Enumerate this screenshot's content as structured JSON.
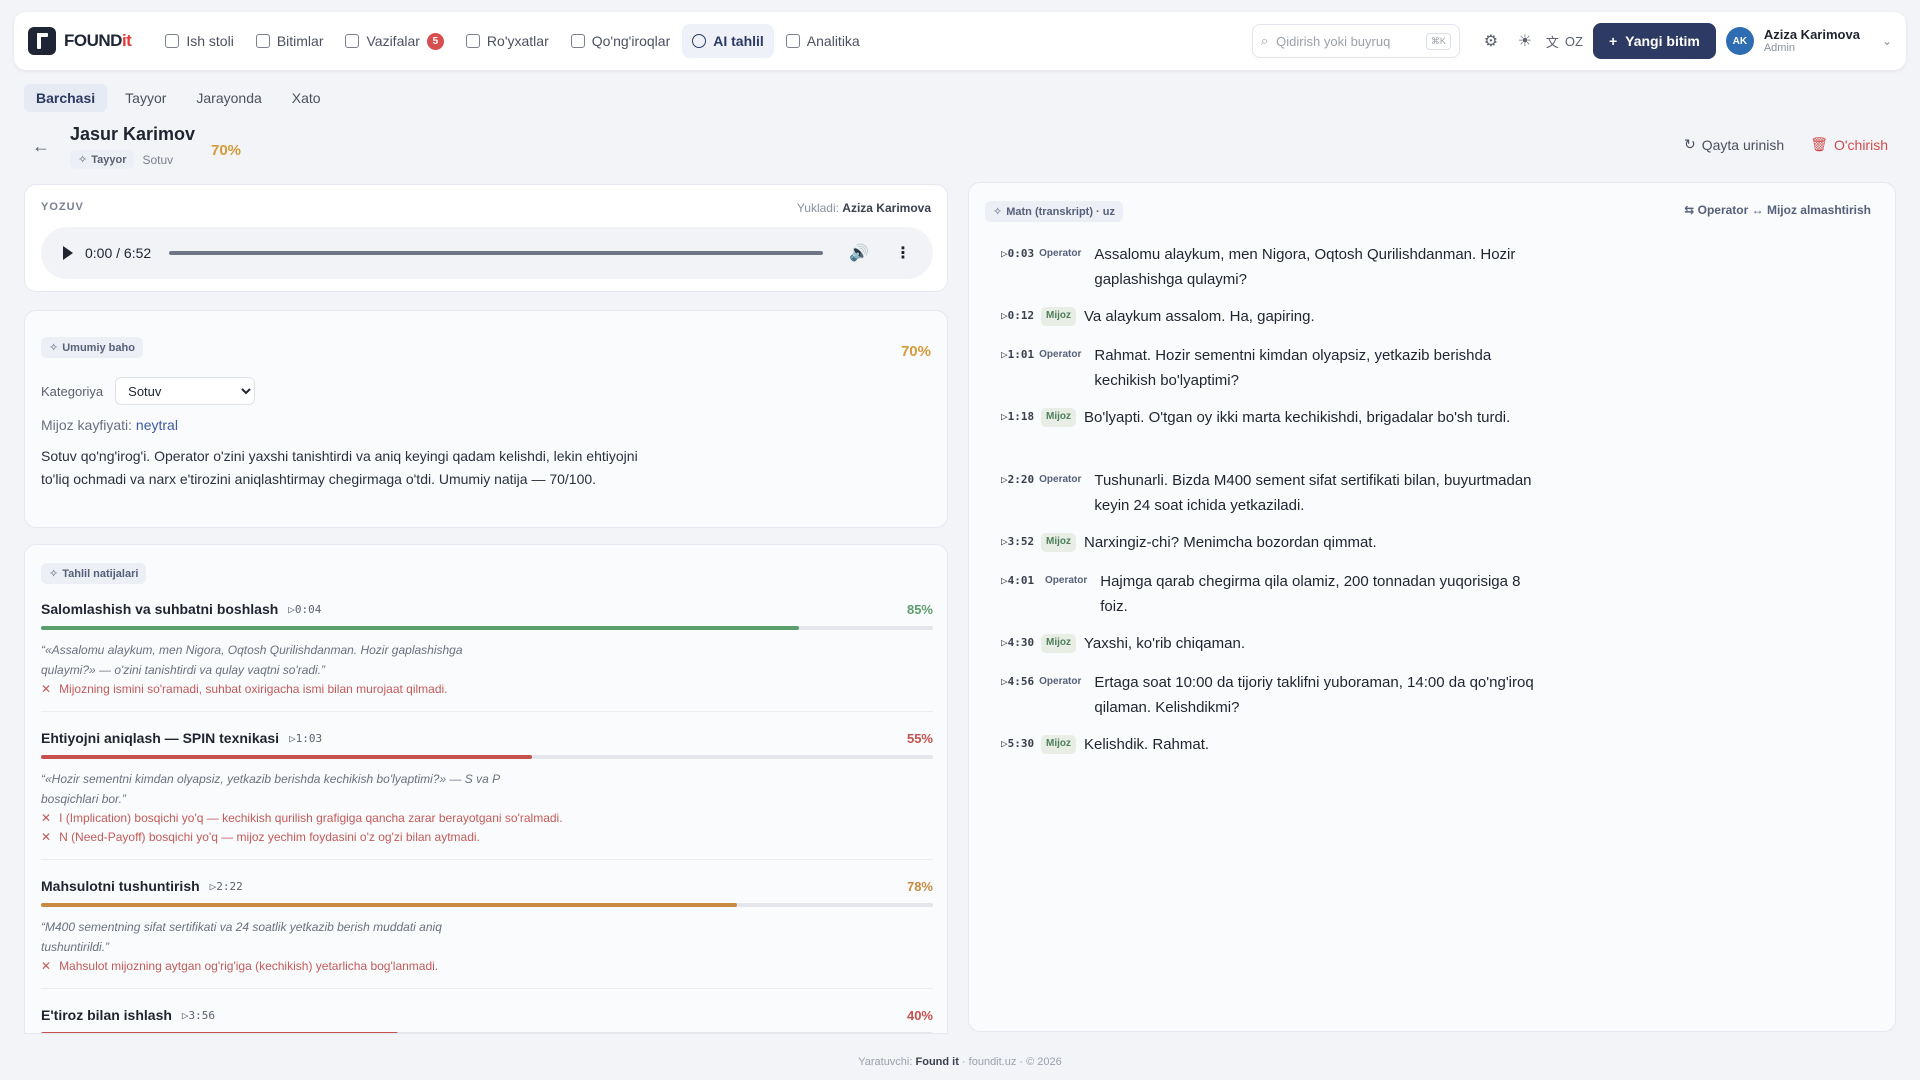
{
  "brand": {
    "prefix": "FOUND",
    "suffix": "it"
  },
  "nav": [
    {
      "label": "Ish stoli",
      "icon": "desk-icon"
    },
    {
      "label": "Bitimlar",
      "icon": "handshake-icon"
    },
    {
      "label": "Vazifalar",
      "icon": "checkbox-icon",
      "badge": "5"
    },
    {
      "label": "Ro'yxatlar",
      "icon": "list-icon"
    },
    {
      "label": "Qo'ng'iroqlar",
      "icon": "phone-icon"
    },
    {
      "label": "AI tahlil",
      "icon": "sparkle-icon",
      "active": true
    },
    {
      "label": "Analitika",
      "icon": "chart-icon"
    }
  ],
  "search": {
    "placeholder": "Qidirish yoki buyruq",
    "shortcut": "⌘K"
  },
  "lang": "OZ",
  "new_button": "Yangi bitim",
  "user": {
    "initials": "AK",
    "name": "Aziza Karimova",
    "role": "Admin"
  },
  "filter_tabs": [
    "Barchasi",
    "Tayyor",
    "Jarayonda",
    "Xato"
  ],
  "call": {
    "title": "Jasur Karimov",
    "status": "Tayyor",
    "category": "Sotuv",
    "score": "70%",
    "retry": "Qayta urinish",
    "delete": "O'chirish"
  },
  "audio": {
    "label": "YOZUV",
    "uploader_label": "Yukladi:",
    "uploader": "Aziza Karimova",
    "time": "0:00 / 6:52"
  },
  "overall": {
    "chip": "Umumiy baho",
    "score": "70%",
    "category_label": "Kategoriya",
    "category_value": "Sotuv",
    "mood_label": "Mijoz kayfiyati:",
    "mood_value": "neytral",
    "summary": "Sotuv qo'ng'irog'i. Operator o'zini yaxshi tanishtirdi va aniq keyingi qadam kelishdi, lekin ehtiyojni to'liq ochmadi va narx e'tirozini aniqlashtirmay chegirmaga o'tdi. Umumiy natija — 70/100."
  },
  "results": {
    "chip": "Tahlil natijalari",
    "metrics": [
      {
        "title": "Salomlashish va suhbatni boshlash",
        "time": "▷0:04",
        "pct": "85%",
        "value": 0.85,
        "color": "#5b9e6d",
        "quote": "“«Assalomu alaykum, men Nigora, Oqtosh Qurilishdanman. Hozir gaplashishga qulaymi?» — o'zini tanishtirdi va qulay vaqtni so'radi.”",
        "issues": [
          "Mijozning ismini so'ramadi, suhbat oxirigacha ismi bilan murojaat qilmadi."
        ]
      },
      {
        "title": "Ehtiyojni aniqlash — SPIN texnikasi",
        "time": "▷1:03",
        "pct": "55%",
        "value": 0.55,
        "color": "#c6504e",
        "quote": "“«Hozir sementni kimdan olyapsiz, yetkazib berishda kechikish bo'lyaptimi?» — S va P bosqichlari bor.”",
        "issues": [
          "I (Implication) bosqichi yo'q — kechikish qurilish grafigiga qancha zarar berayotgani so'ralmadi.",
          "N (Need-Payoff) bosqichi yo'q — mijoz yechim foydasini o'z og'zi bilan aytmadi."
        ]
      },
      {
        "title": "Mahsulotni tushuntirish",
        "time": "▷2:22",
        "pct": "78%",
        "value": 0.78,
        "color": "#c98a42",
        "quote": "“M400 sementning sifat sertifikati va 24 soatlik yetkazib berish muddati aniq tushuntirildi.”",
        "issues": [
          "Mahsulot mijozning aytgan og'rig'iga (kechikish) yetarlicha bog'lanmadi."
        ]
      },
      {
        "title": "E'tiroz bilan ishlash",
        "time": "▷3:56",
        "pct": "40%",
        "value": 0.4,
        "color": "#c6504e",
        "quote": "",
        "issues": []
      }
    ]
  },
  "transcript": {
    "chip": "Matn (transkript) · uz",
    "swap": "⇆ Operator ↔ Mijoz almashtirish",
    "lines": [
      {
        "time": "▷0:03",
        "speaker": "Operator",
        "role": "op",
        "text": "Assalomu alaykum, men Nigora, Oqtosh Qurilishdanman. Hozir gaplashishga qulaymi?"
      },
      {
        "time": "▷0:12",
        "speaker": "Mijoz",
        "role": "mj",
        "text": "Va alaykum assalom. Ha, gapiring."
      },
      {
        "time": "▷1:01",
        "speaker": "Operator",
        "role": "op",
        "text": "Rahmat. Hozir sementni kimdan olyapsiz, yetkazib berishda kechikish bo'lyaptimi?"
      },
      {
        "time": "▷1:18",
        "speaker": "Mijoz",
        "role": "mj",
        "text": "Bo'lyapti. O'tgan oy ikki marta kechikishdi, brigadalar bo'sh turdi."
      },
      {
        "time": "▷2:20",
        "speaker": "Operator",
        "role": "op",
        "text": "Tushunarli. Bizda M400 sement sifat sertifikati bilan, buyurtmadan keyin 24 soat ichida yetkaziladi."
      },
      {
        "time": "▷3:52",
        "speaker": "Mijoz",
        "role": "mj",
        "text": "Narxingiz-chi? Menimcha bozordan qimmat."
      },
      {
        "time": "▷4:01",
        "speaker": "Operator",
        "role": "op",
        "text": "Hajmga qarab chegirma qila olamiz, 200 tonnadan yuqorisiga 8 foiz."
      },
      {
        "time": "▷4:30",
        "speaker": "Mijoz",
        "role": "mj",
        "text": "Yaxshi, ko'rib chiqaman."
      },
      {
        "time": "▷4:56",
        "speaker": "Operator",
        "role": "op",
        "text": "Ertaga soat 10:00 da tijoriy taklifni yuboraman, 14:00 da qo'ng'iroq qilaman. Kelishdikmi?"
      },
      {
        "time": "▷5:30",
        "speaker": "Mijoz",
        "role": "mj",
        "text": "Kelishdik. Rahmat."
      }
    ]
  },
  "footer": {
    "label": "Yaratuvchi:",
    "brand": "Found it",
    "site": "foundit.uz",
    "year": "© 2026"
  }
}
